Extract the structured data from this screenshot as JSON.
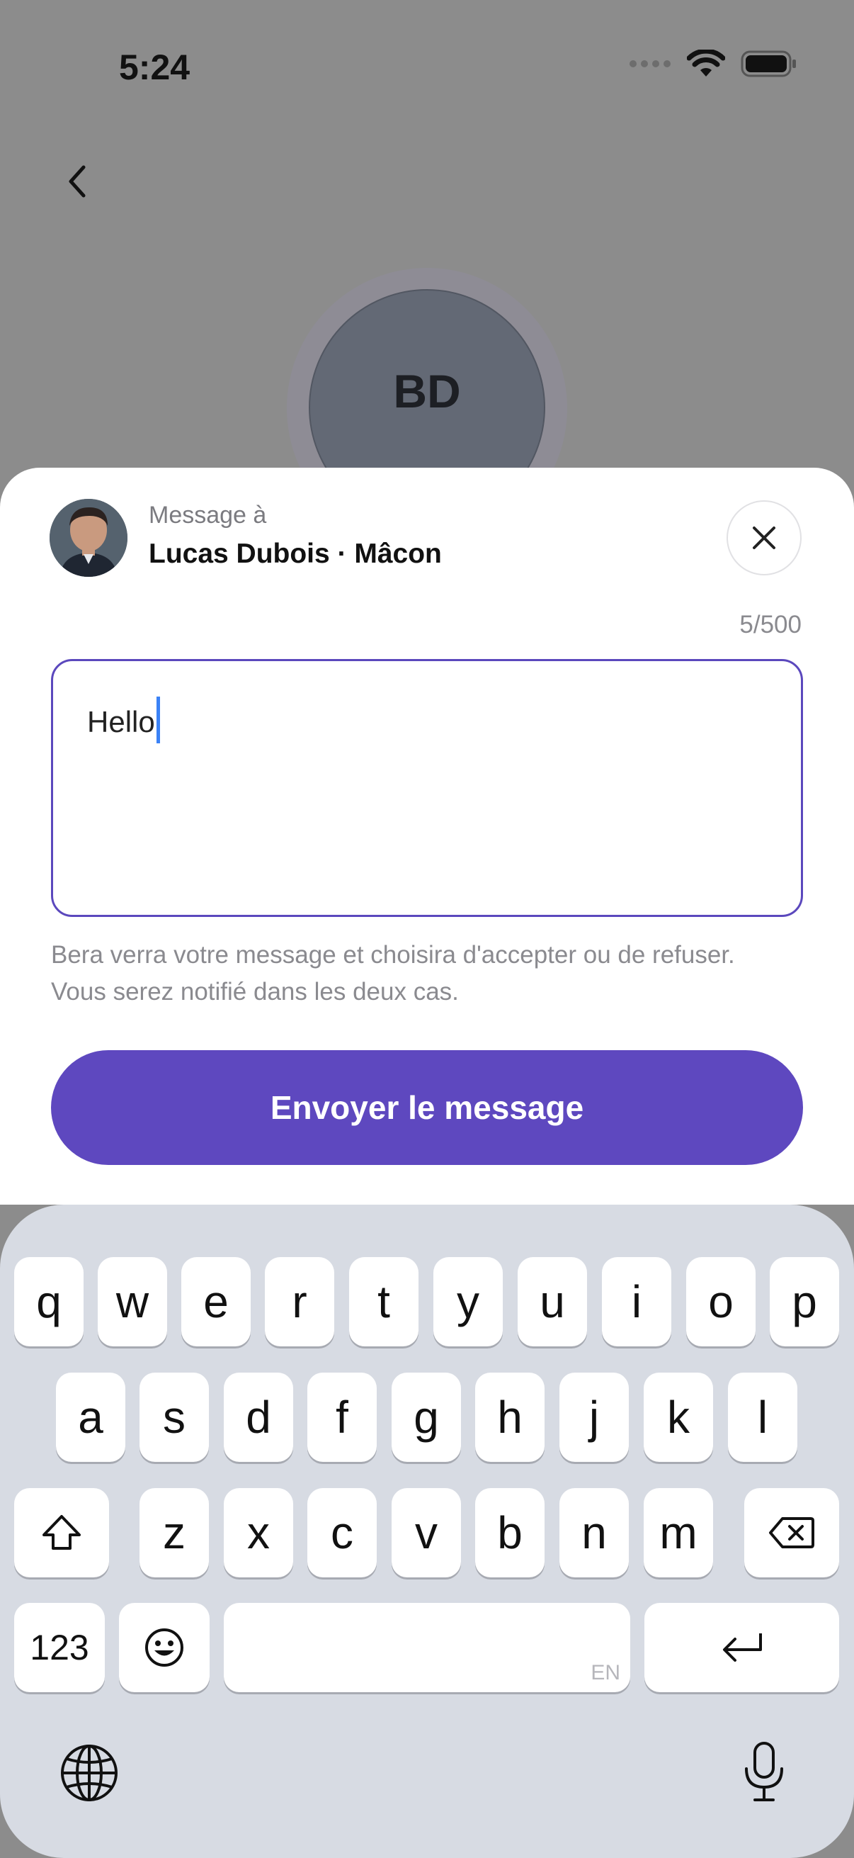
{
  "status_bar": {
    "time": "5:24"
  },
  "background_profile": {
    "initials": "BD"
  },
  "sheet": {
    "sender_subtitle": "Message à",
    "sender_name": "Lucas Dubois · Mâcon",
    "counter": "5/500",
    "message_value": "Hello",
    "hint_line1": "Bera verra votre message et choisira d'accepter ou de refuser.",
    "hint_line2": "Vous serez notifié dans les deux cas.",
    "send_label": "Envoyer le message"
  },
  "keyboard": {
    "row1": [
      "q",
      "w",
      "e",
      "r",
      "t",
      "y",
      "u",
      "i",
      "o",
      "p"
    ],
    "row2": [
      "a",
      "s",
      "d",
      "f",
      "g",
      "h",
      "j",
      "k",
      "l"
    ],
    "row3": [
      "z",
      "x",
      "c",
      "v",
      "b",
      "n",
      "m"
    ],
    "numbers_label": "123",
    "language_label": "EN"
  },
  "colors": {
    "accent": "#5e48bf",
    "caret": "#3b82f6",
    "keyboard_bg": "#d7dbe3"
  },
  "icons": [
    "back-chevron-icon",
    "close-icon",
    "shift-icon",
    "delete-icon",
    "emoji-icon",
    "return-icon",
    "globe-icon",
    "microphone-icon",
    "wifi-icon",
    "battery-icon",
    "signal-icon"
  ]
}
